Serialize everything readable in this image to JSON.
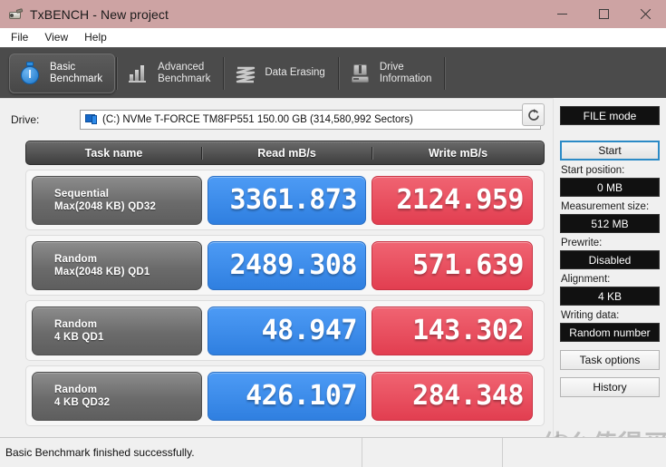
{
  "window": {
    "title": "TxBENCH - New project",
    "icon": "app-icon",
    "controls": {
      "minimize": "minimize",
      "maximize": "maximize",
      "close": "close"
    }
  },
  "menu": {
    "items": [
      {
        "label": "File"
      },
      {
        "label": "View"
      },
      {
        "label": "Help"
      }
    ]
  },
  "tabs": [
    {
      "label": "Basic\nBenchmark",
      "icon": "stopwatch-icon",
      "active": true
    },
    {
      "label": "Advanced\nBenchmark",
      "icon": "bar-chart-icon",
      "active": false
    },
    {
      "label": "Data Erasing",
      "icon": "shredder-icon",
      "active": false
    },
    {
      "label": "Drive\nInformation",
      "icon": "drive-info-icon",
      "active": false
    }
  ],
  "drive": {
    "label": "Drive:",
    "selected": "(C:) NVMe T-FORCE TM8FP551  150.00 GB (314,580,992 Sectors)",
    "refresh_icon": "refresh-icon",
    "dropdown_icon": "chevron-down-icon"
  },
  "results": {
    "columns": [
      "Task name",
      "Read mB/s",
      "Write mB/s"
    ],
    "rows": [
      {
        "task_line1": "Sequential",
        "task_line2": "Max(2048 KB) QD32",
        "read": "3361.873",
        "write": "2124.959"
      },
      {
        "task_line1": "Random",
        "task_line2": "Max(2048 KB) QD1",
        "read": "2489.308",
        "write": "571.639"
      },
      {
        "task_line1": "Random",
        "task_line2": "4 KB QD1",
        "read": "48.947",
        "write": "143.302"
      },
      {
        "task_line1": "Random",
        "task_line2": "4 KB QD32",
        "read": "426.107",
        "write": "284.348"
      }
    ]
  },
  "sidebar": {
    "mode_value": "FILE mode",
    "start_label": "Start",
    "start_position_label": "Start position:",
    "start_position_value": "0 MB",
    "measurement_size_label": "Measurement size:",
    "measurement_size_value": "512 MB",
    "prewrite_label": "Prewrite:",
    "prewrite_value": "Disabled",
    "alignment_label": "Alignment:",
    "alignment_value": "4 KB",
    "writing_data_label": "Writing data:",
    "writing_data_value": "Random number",
    "task_options_label": "Task options",
    "history_label": "History"
  },
  "status": {
    "message": "Basic Benchmark finished successfully."
  },
  "watermark": {
    "text": "什么值得买",
    "badge": "值"
  },
  "colors": {
    "titlebar": "#cda3a3",
    "tabstrip": "#4b4b4b",
    "read_accent": "#3b8ef0",
    "write_accent": "#e8505f",
    "start_focus": "#2b8ac6",
    "value_field_bg": "#111111"
  }
}
